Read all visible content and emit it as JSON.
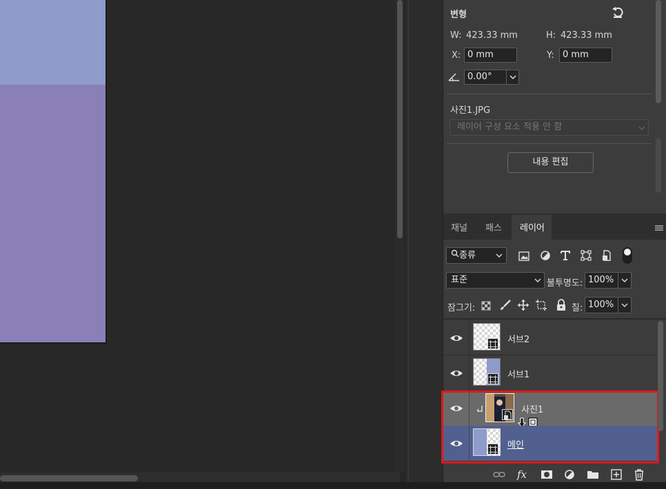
{
  "properties": {
    "section_title": "변형",
    "w_label": "W:",
    "w_value": "423.33 mm",
    "h_label": "H:",
    "h_value": "423.33 mm",
    "x_label": "X:",
    "x_value": "0 mm",
    "y_label": "Y:",
    "y_value": "0 mm",
    "angle_value": "0.00°",
    "file_name": "사진1.JPG",
    "layer_comp_placeholder": "레이어 구성 요소 적용 안 함",
    "edit_button": "내용 편집"
  },
  "layers_panel": {
    "tabs": [
      "채널",
      "패스",
      "레이어"
    ],
    "active_tab": "레이어",
    "filter_label": "종류",
    "blend_mode": "표준",
    "opacity_label": "불투명도:",
    "opacity_value": "100%",
    "lock_label": "잠그기:",
    "fill_label": "칠:",
    "fill_value": "100%",
    "layers": [
      {
        "name": "서브2"
      },
      {
        "name": "서브1"
      },
      {
        "name": "사진1"
      },
      {
        "name": "메인"
      }
    ]
  },
  "colors": {
    "doc_top": "#8f9bcb",
    "doc_bottom": "#8a80b7",
    "selected_layer": "#52608f",
    "highlight_box": "#e01818"
  }
}
